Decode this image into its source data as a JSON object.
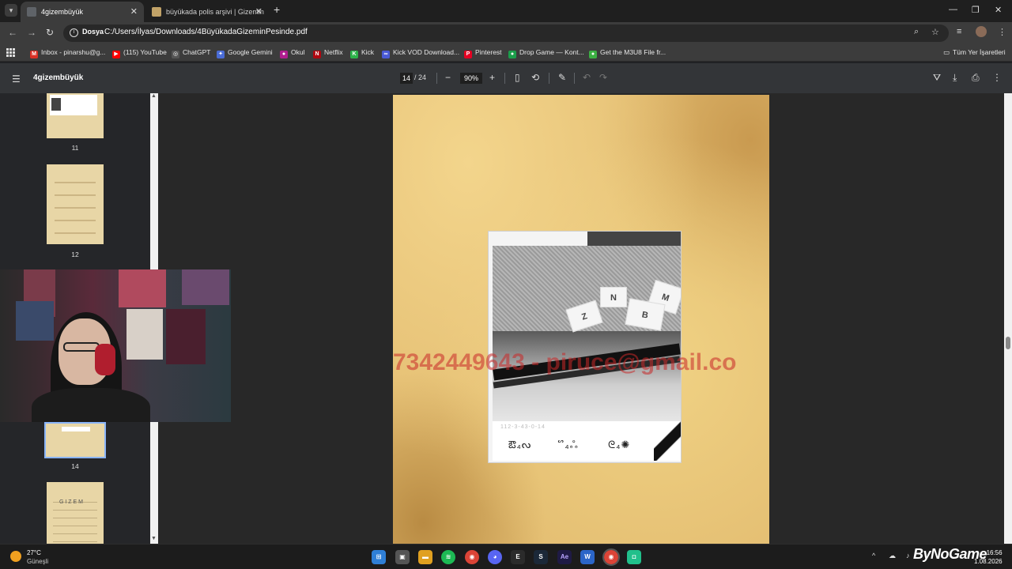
{
  "tabs": [
    {
      "title": "4gizembüyük",
      "active": true
    },
    {
      "title": "büyükada polis arşivi | Gizemin",
      "active": false
    }
  ],
  "window": {
    "minimize": "—",
    "restore": "❐",
    "close": "✕"
  },
  "address": {
    "chip": "Dosya",
    "url": "C:/Users/İlyas/Downloads/4BüyükadaGizeminPesinde.pdf"
  },
  "bookmarks": [
    {
      "label": "Inbox - pinarshu@g...",
      "icon": "gmail-icon",
      "color": "#d93025",
      "glyph": "M"
    },
    {
      "label": "(115) YouTube",
      "icon": "youtube-icon",
      "color": "#ff0000",
      "glyph": "▶"
    },
    {
      "label": "ChatGPT",
      "icon": "chatgpt-icon",
      "color": "#555555",
      "glyph": "◎"
    },
    {
      "label": "Google Gemini",
      "icon": "gemini-icon",
      "color": "#4a6cd6",
      "glyph": "✦"
    },
    {
      "label": "Okul",
      "icon": "okul-icon",
      "color": "#b01e8f",
      "glyph": "●"
    },
    {
      "label": "Netflix",
      "icon": "netflix-icon",
      "color": "#b00710",
      "glyph": "N"
    },
    {
      "label": "Kick",
      "icon": "kick-icon",
      "color": "#2db34a",
      "glyph": "K"
    },
    {
      "label": "Kick VOD Download...",
      "icon": "kickvod-icon",
      "color": "#4a5ad6",
      "glyph": "∞"
    },
    {
      "label": "Pinterest",
      "icon": "pinterest-icon",
      "color": "#e60023",
      "glyph": "P"
    },
    {
      "label": "Drop Game — Kont...",
      "icon": "dropgame-icon",
      "color": "#1b9e4b",
      "glyph": "●"
    },
    {
      "label": "Get the M3U8 File fr...",
      "icon": "m3u8-icon",
      "color": "#3cb043",
      "glyph": "●"
    }
  ],
  "bookmarks_all": "Tüm Yer İşaretleri",
  "pdf": {
    "title": "4gizembüyük",
    "page": "14",
    "total": "/ 24",
    "zoom": "90%"
  },
  "thumbnails": [
    {
      "label": "11"
    },
    {
      "label": "12"
    },
    {
      "label": "14"
    },
    {
      "label": ""
    }
  ],
  "page_content": {
    "watermark": "7342449643 - piruce@gmail.co",
    "photo_number": "112-3-43-0-14",
    "scraps": [
      "M",
      "Z",
      "B",
      "N"
    ],
    "cipher": [
      "ఔ₄ᔓ",
      "ᔥ₄ஃ",
      "ᘓ₄✺"
    ]
  },
  "taskbar": {
    "temp": "27°C",
    "weather": "Güneşli",
    "brand": "ByNoGame",
    "time": "16:56",
    "date": "1.08.2026"
  }
}
